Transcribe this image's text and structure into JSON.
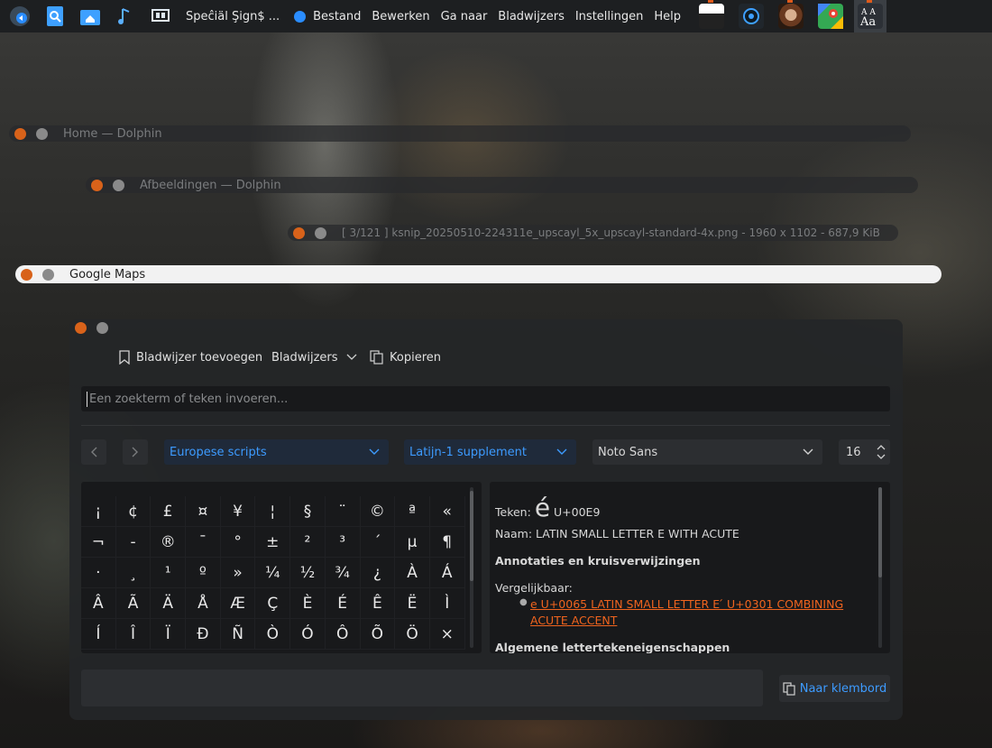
{
  "panel": {
    "app_title": "Speĉiäl Şign$ ...",
    "menu": [
      "Bestand",
      "Bewerken",
      "Ga naar",
      "Bladwijzers",
      "Instellingen",
      "Help"
    ]
  },
  "windows": {
    "home": "Home — Dolphin",
    "afbeeldingen": "Afbeeldingen — Dolphin",
    "image_viewer": "[ 3/121 ] ksnip_20250510-224311e_upscayl_5x_upscayl-standard-4x.png - 1960 x 1102 - 687,9 KiB",
    "maps": "Google Maps"
  },
  "toolbar": {
    "bookmark_add": "Bladwijzer toevoegen",
    "bookmarks": "Bladwijzers",
    "copy": "Kopieren"
  },
  "search": {
    "placeholder": "Een zoekterm of teken invoeren..."
  },
  "filters": {
    "script": "Europese scripts",
    "block": "Latijn-1 supplement",
    "font": "Noto Sans",
    "size": "16"
  },
  "grid": {
    "rows": [
      [
        "¡",
        "¢",
        "£",
        "¤",
        "¥",
        "¦",
        "§",
        "¨",
        "©",
        "ª",
        "«"
      ],
      [
        "¬",
        "-",
        "®",
        "¯",
        "°",
        "±",
        "²",
        "³",
        "´",
        "µ",
        "¶"
      ],
      [
        "·",
        "¸",
        "¹",
        "º",
        "»",
        "¼",
        "½",
        "¾",
        "¿",
        "À",
        "Á"
      ],
      [
        "Â",
        "Ã",
        "Ä",
        "Å",
        "Æ",
        "Ç",
        "È",
        "É",
        "Ê",
        "Ë",
        "Ì"
      ],
      [
        "Í",
        "Î",
        "Ï",
        "Ð",
        "Ñ",
        "Ò",
        "Ó",
        "Ô",
        "Õ",
        "Ö",
        "×"
      ]
    ]
  },
  "detail": {
    "teken_label": "Teken:",
    "glyph": "é",
    "code": "U+00E9",
    "name_line": "Naam: LATIN SMALL LETTER E WITH ACUTE",
    "annotations_heading": "Annotaties en kruisverwijzingen",
    "similar_label": "Vergelijkbaar:",
    "similar_line1": "e U+0065 LATIN SMALL LETTER E ́ U+0301 COMBINING",
    "similar_line2": "ACUTE ACCENT",
    "general_heading": "Algemene lettertekeneigenschappen"
  },
  "clipboard_button": "Naar klembord",
  "colors": {
    "accent": "#3d9bff",
    "link": "#f0641e",
    "close": "#d8621a"
  }
}
